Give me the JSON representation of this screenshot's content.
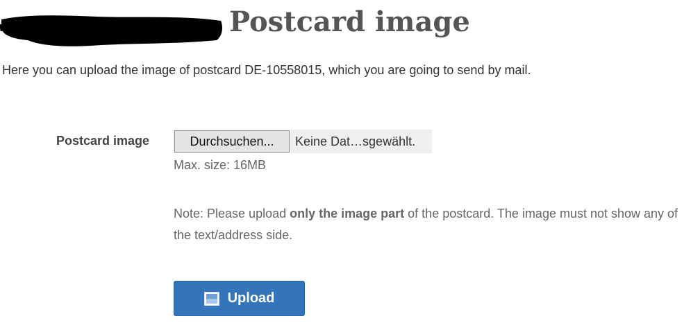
{
  "header": {
    "title": "Postcard image"
  },
  "intro": {
    "text": "Here you can upload the image of postcard DE-10558015, which you are going to send by mail."
  },
  "form": {
    "field_label": "Postcard image",
    "browse_button_label": "Durchsuchen...",
    "file_status": "Keine Dat…sgewählt.",
    "max_size": "Max. size: 16MB",
    "note": {
      "prefix": "Note: Please upload ",
      "emphasis": "only the image part",
      "suffix": " of the postcard. The image must not show any of the text/address side."
    },
    "upload_button_label": "Upload",
    "upload_icon": "image-icon"
  },
  "colors": {
    "upload_button_bg": "#3374bb",
    "title": "#555555",
    "text": "#333333",
    "muted_text": "#666666"
  }
}
